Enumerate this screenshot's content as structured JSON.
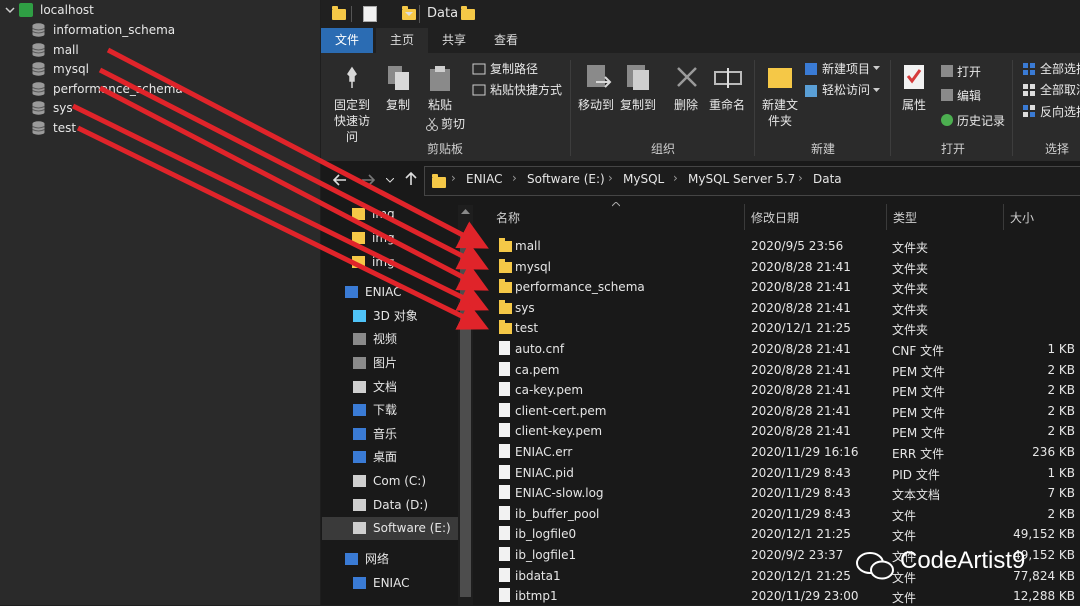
{
  "db_tree": {
    "root": "localhost",
    "databases": [
      "information_schema",
      "mall",
      "mysql",
      "performance_schema",
      "sys",
      "test"
    ]
  },
  "explorer": {
    "title": "Data",
    "tabs": [
      "文件",
      "主页",
      "共享",
      "查看"
    ],
    "ribbon": {
      "pin_label": "固定到快速访问",
      "copy": "复制",
      "paste": "粘贴",
      "copy_path": "复制路径",
      "paste_shortcut": "粘贴快捷方式",
      "cut": "剪切",
      "group_clipboard": "剪贴板",
      "move_to": "移动到",
      "copy_to": "复制到",
      "delete": "删除",
      "rename": "重命名",
      "group_organize": "组织",
      "new_folder": "新建文件夹",
      "new_item": "新建项目",
      "easy_access": "轻松访问",
      "group_new": "新建",
      "properties": "属性",
      "open": "打开",
      "edit": "编辑",
      "history": "历史记录",
      "group_open": "打开",
      "select_all": "全部选择",
      "select_none": "全部取消",
      "invert": "反向选择",
      "group_select": "选择"
    },
    "breadcrumb": [
      "ENIAC",
      "Software (E:)",
      "MySQL",
      "MySQL Server 5.7",
      "Data"
    ],
    "nav": [
      "img",
      "img",
      "img",
      "ENIAC",
      "3D 对象",
      "视频",
      "图片",
      "文档",
      "下载",
      "音乐",
      "桌面",
      "Com (C:)",
      "Data (D:)",
      "Software (E:)",
      "网络",
      "ENIAC"
    ],
    "columns": {
      "name": "名称",
      "date": "修改日期",
      "type": "类型",
      "size": "大小"
    },
    "files": [
      {
        "name": "mall",
        "date": "2020/9/5 23:56",
        "type": "文件夹",
        "size": "",
        "folder": true
      },
      {
        "name": "mysql",
        "date": "2020/8/28 21:41",
        "type": "文件夹",
        "size": "",
        "folder": true
      },
      {
        "name": "performance_schema",
        "date": "2020/8/28 21:41",
        "type": "文件夹",
        "size": "",
        "folder": true
      },
      {
        "name": "sys",
        "date": "2020/8/28 21:41",
        "type": "文件夹",
        "size": "",
        "folder": true
      },
      {
        "name": "test",
        "date": "2020/12/1 21:25",
        "type": "文件夹",
        "size": "",
        "folder": true
      },
      {
        "name": "auto.cnf",
        "date": "2020/8/28 21:41",
        "type": "CNF 文件",
        "size": "1 KB"
      },
      {
        "name": "ca.pem",
        "date": "2020/8/28 21:41",
        "type": "PEM 文件",
        "size": "2 KB"
      },
      {
        "name": "ca-key.pem",
        "date": "2020/8/28 21:41",
        "type": "PEM 文件",
        "size": "2 KB"
      },
      {
        "name": "client-cert.pem",
        "date": "2020/8/28 21:41",
        "type": "PEM 文件",
        "size": "2 KB"
      },
      {
        "name": "client-key.pem",
        "date": "2020/8/28 21:41",
        "type": "PEM 文件",
        "size": "2 KB"
      },
      {
        "name": "ENIAC.err",
        "date": "2020/11/29 16:16",
        "type": "ERR 文件",
        "size": "236 KB"
      },
      {
        "name": "ENIAC.pid",
        "date": "2020/11/29 8:43",
        "type": "PID 文件",
        "size": "1 KB"
      },
      {
        "name": "ENIAC-slow.log",
        "date": "2020/11/29 8:43",
        "type": "文本文档",
        "size": "7 KB"
      },
      {
        "name": "ib_buffer_pool",
        "date": "2020/11/29 8:43",
        "type": "文件",
        "size": "2 KB"
      },
      {
        "name": "ib_logfile0",
        "date": "2020/12/1 21:25",
        "type": "文件",
        "size": "49,152 KB"
      },
      {
        "name": "ib_logfile1",
        "date": "2020/9/2 23:37",
        "type": "文件",
        "size": "49,152 KB"
      },
      {
        "name": "ibdata1",
        "date": "2020/12/1 21:25",
        "type": "文件",
        "size": "77,824 KB"
      },
      {
        "name": "ibtmp1",
        "date": "2020/11/29 23:00",
        "type": "文件",
        "size": "12,288 KB"
      }
    ]
  },
  "watermark": "CodeArtist9"
}
